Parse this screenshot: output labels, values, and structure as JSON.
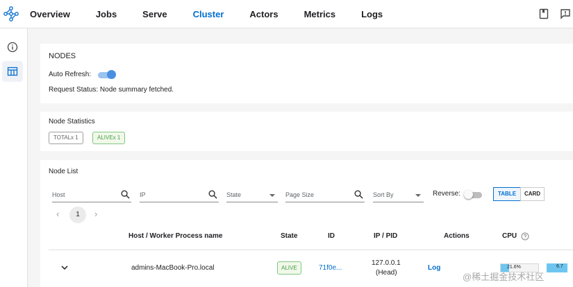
{
  "nav": {
    "items": [
      {
        "label": "Overview",
        "active": false
      },
      {
        "label": "Jobs",
        "active": false
      },
      {
        "label": "Serve",
        "active": false
      },
      {
        "label": "Cluster",
        "active": true
      },
      {
        "label": "Actors",
        "active": false
      },
      {
        "label": "Metrics",
        "active": false
      },
      {
        "label": "Logs",
        "active": false
      }
    ],
    "right_icons": [
      "docs-book-icon",
      "feedback-icon"
    ]
  },
  "sidebar": {
    "items": [
      {
        "icon": "info-icon",
        "active": false
      },
      {
        "icon": "table-icon",
        "active": true
      }
    ]
  },
  "nodes_panel": {
    "title": "NODES",
    "auto_refresh_label": "Auto Refresh:",
    "auto_refresh_on": true,
    "request_status": "Request Status: Node summary fetched."
  },
  "node_statistics": {
    "title": "Node Statistics",
    "total_chip": "TOTALx 1",
    "alive_chip": "ALIVEx 1"
  },
  "node_list": {
    "title": "Node List",
    "filters": {
      "host": "Host",
      "ip": "IP",
      "state": "State",
      "page_size": "Page Size",
      "sort_by": "Sort By"
    },
    "reverse_label": "Reverse:",
    "reverse_on": false,
    "view_table": "TABLE",
    "view_card": "CARD",
    "pagination": {
      "prev": "‹",
      "current": "1",
      "next": "›"
    },
    "columns": [
      "Host / Worker Process name",
      "State",
      "ID",
      "IP / PID",
      "Actions",
      "CPU"
    ],
    "row": {
      "expand": "⌄",
      "host": "admins-MacBook-Pro.local",
      "state": "ALIVE",
      "id": "71f0e...",
      "ip": "127.0.0.1",
      "pid": "(Head)",
      "action": "Log",
      "cpu": "21.6%",
      "cpu_value": 21.6,
      "next_bar_text": "6.7"
    }
  },
  "watermark": "@稀土掘金技术社区",
  "colors": {
    "accent": "#036DCF",
    "toggle_on": "#4a90e2",
    "alive_green": "#43a047",
    "cpu_bar": "#6ec6f0"
  }
}
